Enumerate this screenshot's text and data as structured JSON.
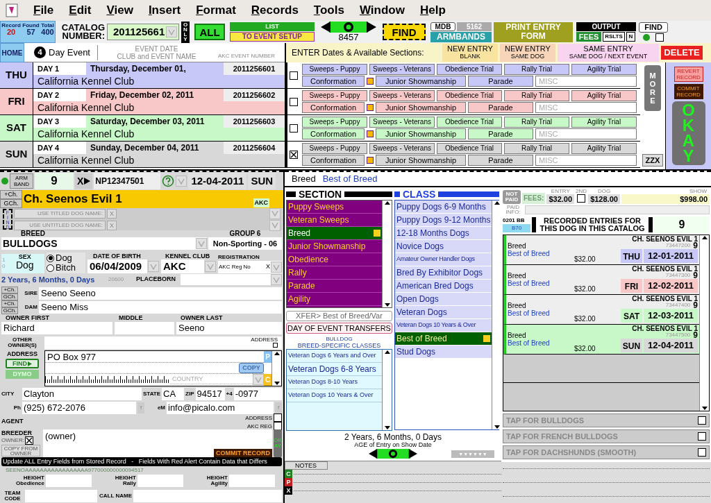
{
  "menu": [
    "File",
    "Edit",
    "View",
    "Insert",
    "Format",
    "Records",
    "Tools",
    "Window",
    "Help"
  ],
  "toolbar": {
    "counts": [
      {
        "label": "Record",
        "value": "20"
      },
      {
        "label": "Found",
        "value": "57"
      },
      {
        "label": "Total",
        "value": "400"
      }
    ],
    "home": "HOME",
    "catalog_label": "CATALOG NUMBER:",
    "catalog_number": "201125661",
    "only": "ONLY",
    "all": "ALL",
    "list": "LIST",
    "event_setup": "TO EVENT SETUP",
    "nav_count": "8457",
    "find": "FIND",
    "mdb": "MDB",
    "mdb_count": "5162",
    "armbands": "ARMBANDS",
    "print": "PRINT ENTRY FORM",
    "output": "OUTPUT",
    "fees": "FEES",
    "rslts": "RSLTS",
    "n": "N",
    "find_small": "FIND",
    "output_checked": false
  },
  "event_header": {
    "day_count": "4",
    "label": "Day Event",
    "col_date": "EVENT DATE",
    "col_club": "CLUB and EVENT NAME",
    "col_number": "AKC EVENT NUMBER",
    "prompt": "ENTER Dates & Available Sections:",
    "buttons": [
      {
        "title": "NEW ENTRY",
        "sub": "BLANK",
        "color": "#f8e4a0"
      },
      {
        "title": "NEW ENTRY",
        "sub": "SAME DOG",
        "color": "#f8d4b8"
      },
      {
        "title": "SAME ENTRY",
        "sub": "SAME DOG / NEXT EVENT",
        "color": "#f8d4f0"
      }
    ],
    "delete": "DELETE"
  },
  "days": [
    {
      "abbr": "THU",
      "day": "DAY 1",
      "date": "Thursday, December 01,",
      "number": "2011256601",
      "club": "California Kennel Club",
      "color": "#c8c8f8",
      "checked": false,
      "sections": [
        "Sweeps - Puppy",
        "Sweeps - Veterans",
        "Obedience Trial",
        "Rally Trial",
        "Agility Trial",
        "Conformation",
        "Junior Showmanship",
        "Parade"
      ],
      "misc": "MISC"
    },
    {
      "abbr": "FRI",
      "day": "DAY 2",
      "date": "Friday, December 02, 2011",
      "number": "2011256602",
      "club": "California Kennel Club",
      "color": "#f8c8c8",
      "checked": false,
      "sections": [
        "Sweeps - Puppy",
        "Sweeps - Veterans",
        "Obedience Trial",
        "Rally Trial",
        "Agility Trial",
        "Conformation",
        "Junior Showmanship",
        "Parade"
      ],
      "misc": "MISC"
    },
    {
      "abbr": "SAT",
      "day": "DAY 3",
      "date": "Saturday, December 03, 2011",
      "number": "2011256603",
      "club": "California Kennel Club",
      "color": "#c8f8c8",
      "checked": false,
      "sections": [
        "Sweeps - Puppy",
        "Sweeps - Veterans",
        "Obedience Trial",
        "Rally Trial",
        "Agility Trial",
        "Conformation",
        "Junior Showmanship",
        "Parade"
      ],
      "misc": "MISC"
    },
    {
      "abbr": "SUN",
      "day": "DAY 4",
      "date": "Sunday, December 04, 2011",
      "number": "2011256604",
      "club": "California Kennel Club",
      "color": "#d8d8d8",
      "checked": true,
      "sections": [
        "Sweeps - Puppy",
        "Sweeps - Veterans",
        "Obedience Trial",
        "Rally Trial",
        "Agility Trial",
        "Conformation",
        "Junior Showmanship",
        "Parade"
      ],
      "misc": "MISC"
    }
  ],
  "side": {
    "more": "MORE",
    "zzx": "ZZX",
    "revert": "REVERT RECORD",
    "commit": "COMMIT RECORD",
    "okay": "OKAY"
  },
  "entry": {
    "armband_label": "ARM BAND",
    "armband": "9",
    "x": "X",
    "registration_number": "NP12347501",
    "date": "12-04-2011",
    "day": "SUN",
    "dog_titles": [
      "+Ch.",
      "GCh."
    ],
    "dog_name": "Ch. Seenos Evil 1",
    "akc": "AKC",
    "find": "FIND",
    "use_buttons": [
      {
        "label": "USE TITLED DOG NAME:",
        "clear": "X"
      },
      {
        "label": "USE UNTITLED DOG NAME:",
        "clear": "X"
      }
    ],
    "breed_label": "BREED",
    "breed": "BULLDOGS",
    "group_label": "GROUP 6",
    "group": "Non-Sporting - 06",
    "sex_label": "SEX",
    "sex": "Dog",
    "sex_codes": [
      "1",
      "0"
    ],
    "sex_options": [
      {
        "label": "Dog",
        "selected": true
      },
      {
        "label": "Bitch",
        "selected": false
      }
    ],
    "dob_label": "DATE OF BIRTH",
    "dob": "06/04/2009",
    "kennel_label": "KENNEL CLUB",
    "kennel": "AKC",
    "registration_label": "REGISTRATION",
    "registration_type": "AKC Reg No",
    "registration_x": "X",
    "age": "2 Years, 6 Months, 0 Days",
    "age_code": "20600",
    "placeborn_label": "PLACEBORN",
    "parents": [
      {
        "titles": [
          "+Ch.",
          "GCh."
        ],
        "label": "SIRE",
        "value": "Seeno Seeno"
      },
      {
        "titles": [
          "+Ch.",
          "GCh."
        ],
        "label": "DAM",
        "value": "Seeno Miss"
      }
    ],
    "owner_first_label": "OWNER FIRST",
    "owner_first": "Richard",
    "middle_label": "MIDDLE",
    "owner_last_label": "OWNER LAST",
    "owner_last": "Seeno",
    "other_owners_label": "OTHER OWNER(S)",
    "address_check_label": "ADDRESS",
    "address_label": "ADDRESS",
    "address_find": "FIND",
    "dymo": "DYMO",
    "address": "PO Box 977",
    "copy": "COPY",
    "p": "P",
    "country": "COUNTRY",
    "c": "C",
    "city_label": "CITY",
    "city": "Clayton",
    "state_label": "STATE",
    "state": "CA",
    "zip_label": "ZIP",
    "zip": "94517",
    "plus4_label": "+4",
    "plus4": "-0977",
    "phone_label": "Ph",
    "phone": "(925) 672-2076",
    "phone_f": "f",
    "email_f": "f",
    "email_label": "eM",
    "email": "info@picalo.com",
    "agent_label": "AGENT",
    "agent_checks": [
      {
        "label": "ADDRESS",
        "checked": false
      },
      {
        "label": "AKC REG",
        "checked": false
      }
    ],
    "breeder_label": "BREEDER",
    "owner_check_label": "OWNER:",
    "owner_checked": true,
    "copy_from_owner": "COPY FROM OWNER",
    "breeder": "(owner)",
    "commit": "COMMIT RECORD",
    "okay": "OKAY",
    "update_bar": "Update ALL Entry Fields from Stored Record   -   Fields With Red Alert Contain Data that Differs",
    "key": "SEENOAAAAAAAAAAAAAAAAA977000000000094517",
    "heights": [
      {
        "label": "HEIGHT",
        "sub": "Obedience"
      },
      {
        "label": "HEIGHT",
        "sub": "Rally"
      },
      {
        "label": "HEIGHT",
        "sub": "Agility"
      }
    ],
    "team_label": "TEAM CODE",
    "call_label": "CALL NAME"
  },
  "middle": {
    "breed": "Breed",
    "class": "Best of Breed",
    "section_title": "SECTION",
    "class_title": "CLASS",
    "sections": [
      {
        "label": "Puppy Sweeps",
        "selected": false
      },
      {
        "label": "Veteran Sweeps",
        "selected": false
      },
      {
        "label": "Breed",
        "selected": true
      },
      {
        "label": "Junior Showmanship",
        "selected": false
      },
      {
        "label": "Obedience",
        "selected": false
      },
      {
        "label": "Rally",
        "selected": false
      },
      {
        "label": "Parade",
        "selected": false
      },
      {
        "label": "Agility",
        "selected": false
      }
    ],
    "classes": [
      {
        "label": "Puppy Dogs 6-9 Months",
        "selected": false
      },
      {
        "label": "Puppy Dogs 9-12 Months",
        "selected": false
      },
      {
        "label": "12-18 Months Dogs",
        "selected": false
      },
      {
        "label": "Novice Dogs",
        "selected": false
      },
      {
        "label": "Amateur Owner Handler Dogs",
        "selected": false
      },
      {
        "label": "Bred By Exhibitor Dogs",
        "selected": false
      },
      {
        "label": "American Bred Dogs",
        "selected": false
      },
      {
        "label": "Open  Dogs",
        "selected": false
      },
      {
        "label": "Veteran Dogs",
        "selected": false
      },
      {
        "label": "Veteran Dogs 10 Years & Over",
        "selected": false
      },
      {
        "label": "Best of Breed",
        "selected": true
      },
      {
        "label": "Stud Dogs",
        "selected": false
      }
    ],
    "xfer": "XFER> Best of Breed/Var",
    "transfers": "DAY OF EVENT TRANSFERS",
    "specific_breed": "BULLDOG",
    "specific_title": "BREED-SPECIFIC CLASSES",
    "specific_classes": [
      "Veteran Dogs 6 Years and Over",
      "Veteran Dogs 6-8 Years",
      "Veteran Dogs 8-10 Years",
      "Veteran Dogs 10 Years & Over"
    ],
    "age": "2 Years, 6 Months, 0 Days",
    "age_caption": "AGE of Entry on Show Date",
    "more": "▼▼▼▼▼▼",
    "notes": "NOTES",
    "note_buttons": [
      "C",
      "P",
      "X"
    ]
  },
  "right": {
    "not_paid": "NOT PAID",
    "fees_label": "FEES:",
    "entry_label": "ENTRY",
    "entry_fee": "$32.00",
    "second_label": "2ND",
    "second_checked": false,
    "dog_label": "DOG",
    "dog_fee": "$128.00",
    "show_label": "SHOW",
    "show_fee": "$998.00",
    "paid_info": "PAID INFO:",
    "code": "0201 BB",
    "code2": "B70",
    "recorded_title": "RECORDED ENTRIES FOR THIS DOG IN THIS CATALOG",
    "recorded_count": "9",
    "entries": [
      {
        "section": "Breed",
        "class": "Best of Breed",
        "fee": "$32.00",
        "dog": "CH. SEENOS EVIL 1",
        "number": "73447200",
        "armband": "9",
        "day": "THU",
        "date": "12-01-2011",
        "color": "#c8c8f8",
        "selected": false
      },
      {
        "section": "Breed",
        "class": "Best of Breed",
        "fee": "$32.00",
        "dog": "CH. SEENOS EVIL 1",
        "number": "73447300",
        "armband": "9",
        "day": "FRI",
        "date": "12-02-2011",
        "color": "#f8c8c8",
        "selected": false
      },
      {
        "section": "Breed",
        "class": "Best of Breed",
        "fee": "$32.00",
        "dog": "CH. SEENOS EVIL 1",
        "number": "73447400",
        "armband": "9",
        "day": "SAT",
        "date": "12-03-2011",
        "color": "#c8f8c8",
        "selected": false
      },
      {
        "section": "Breed",
        "class": "Best of Breed",
        "fee": "$32.00",
        "dog": "CH. SEENOS EVIL 1",
        "number": "73447500",
        "armband": "9",
        "day": "SUN",
        "date": "12-04-2011",
        "color": "#d8d8d8",
        "selected": true
      }
    ],
    "taps": [
      {
        "label": "TAP FOR BULLDOGS",
        "checked": false
      },
      {
        "label": "TAP FOR FRENCH BULLDOGS",
        "checked": false
      },
      {
        "label": "TAP FOR DACHSHUNDS (SMOOTH)",
        "checked": false
      }
    ]
  }
}
